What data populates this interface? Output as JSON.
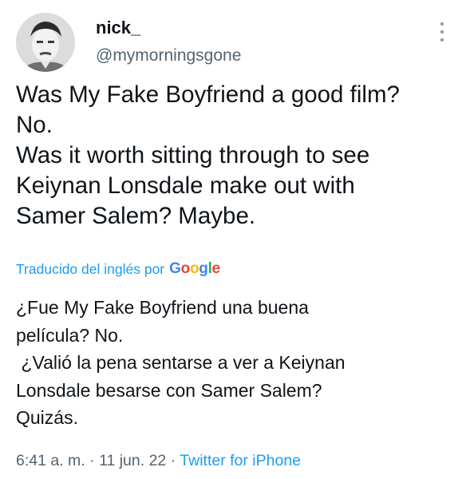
{
  "user": {
    "display_name": "nick_",
    "handle": "@mymorningsgone",
    "avatar_icon": "profile-photo"
  },
  "more_icon": "more-vertical-icon",
  "tweet": {
    "lines": [
      "Was My Fake Boyfriend a good film?",
      "No.",
      "Was it worth sitting through to see",
      "Keiynan Lonsdale make out with",
      "Samer Salem? Maybe."
    ]
  },
  "translation": {
    "label": "Traducido del inglés por",
    "provider": "Google",
    "lines": [
      "¿Fue My Fake Boyfriend una buena",
      "película? No.",
      " ¿Valió la pena sentarse a ver a Keiynan",
      "Lonsdale besarse con Samer Salem?",
      "Quizás."
    ]
  },
  "meta": {
    "time": "6:41 a. m.",
    "separator": "·",
    "date": "11 jun. 22",
    "source": "Twitter for iPhone"
  },
  "colors": {
    "link": "#1d9bf0",
    "secondary_text": "#536471",
    "primary_text": "#0f1419"
  }
}
